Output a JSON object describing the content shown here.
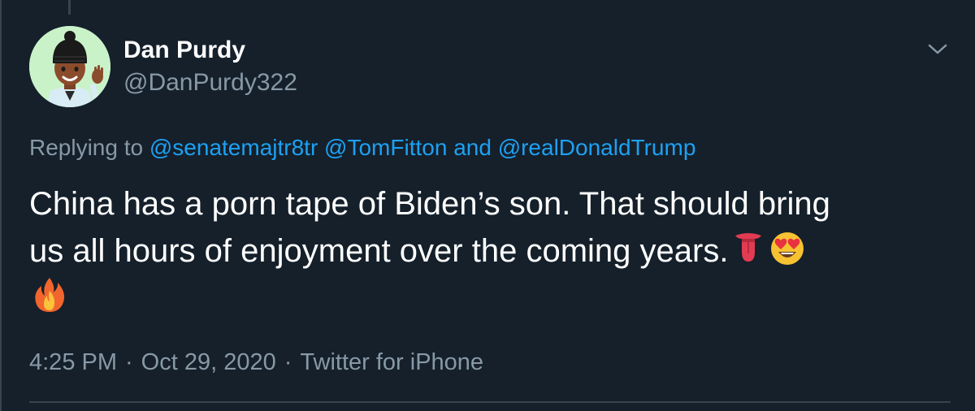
{
  "user": {
    "display_name": "Dan Purdy",
    "handle": "@DanPurdy322"
  },
  "reply": {
    "prefix": "Replying to",
    "mention_1": "@senatemajtr8tr",
    "mention_2": "@TomFitton",
    "conjunction": "and",
    "mention_3": "@realDonaldTrump"
  },
  "tweet": {
    "line_1": "China has a porn tape of Biden’s son. That should bring",
    "line_2": "us all hours of enjoyment over the coming years.",
    "emojis": [
      "tongue-emoji",
      "heart-eyes-emoji",
      "fire-emoji"
    ]
  },
  "meta": {
    "time": "4:25 PM",
    "date": "Oct 29, 2020",
    "source": "Twitter for iPhone",
    "separator": "·"
  },
  "colors": {
    "background": "#15202b",
    "text": "#ffffff",
    "muted": "#8899a6",
    "link": "#1da1f2",
    "divider": "#38444d"
  }
}
